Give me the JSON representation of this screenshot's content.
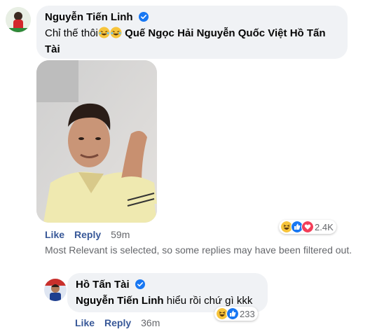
{
  "comment": {
    "author": "Nguyễn Tiến Linh",
    "text": "Chỉ thế thôi",
    "mentions": [
      "Quế Ngọc Hải",
      "Nguyễn Quốc Việt",
      "Hồ Tấn Tài"
    ],
    "like_label": "Like",
    "reply_label": "Reply",
    "time": "59m",
    "reaction_count": "2.4K",
    "reaction_icons": [
      "haha-icon",
      "like-icon",
      "love-icon"
    ]
  },
  "notice": "Most Relevant is selected, so some replies may have been filtered out.",
  "reply": {
    "author": "Hồ Tấn Tài",
    "mention": "Nguyễn Tiến Linh",
    "text": "hiểu rồi chứ gì kkk",
    "like_label": "Like",
    "reply_label": "Reply",
    "time": "36m",
    "reaction_count": "233",
    "reaction_icons": [
      "haha-icon",
      "like-icon"
    ]
  },
  "colors": {
    "bubble": "#f0f2f5",
    "link": "#385898",
    "meta": "#65676b",
    "verified": "#1877f2"
  }
}
